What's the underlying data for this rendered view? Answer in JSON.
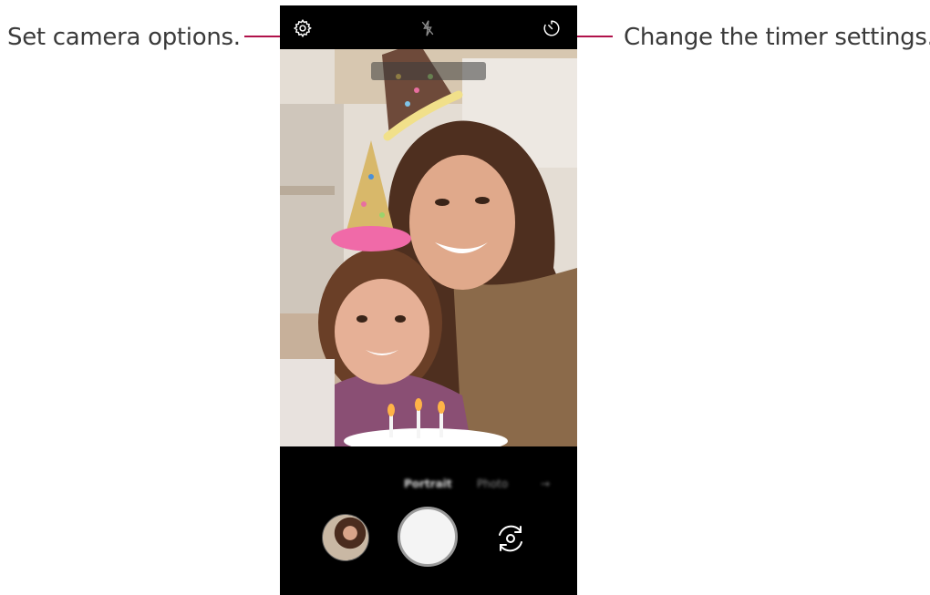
{
  "callouts": {
    "left": "Set camera options.",
    "right": "Change the timer settings."
  },
  "camera": {
    "top_bar": {
      "icons": [
        "settings-icon",
        "flash-icon",
        "timer-icon"
      ]
    },
    "modes": {
      "portrait": "Portrait",
      "photo": "Photo",
      "more": "→",
      "selected": "Portrait"
    },
    "controls": {
      "icons": [
        "gallery-thumbnail",
        "shutter-button",
        "switch-camera-icon"
      ]
    }
  },
  "colors": {
    "callout_line": "#b0124a",
    "text": "#3a3a3a",
    "background": "#ffffff",
    "camera_ui": "#000000"
  }
}
